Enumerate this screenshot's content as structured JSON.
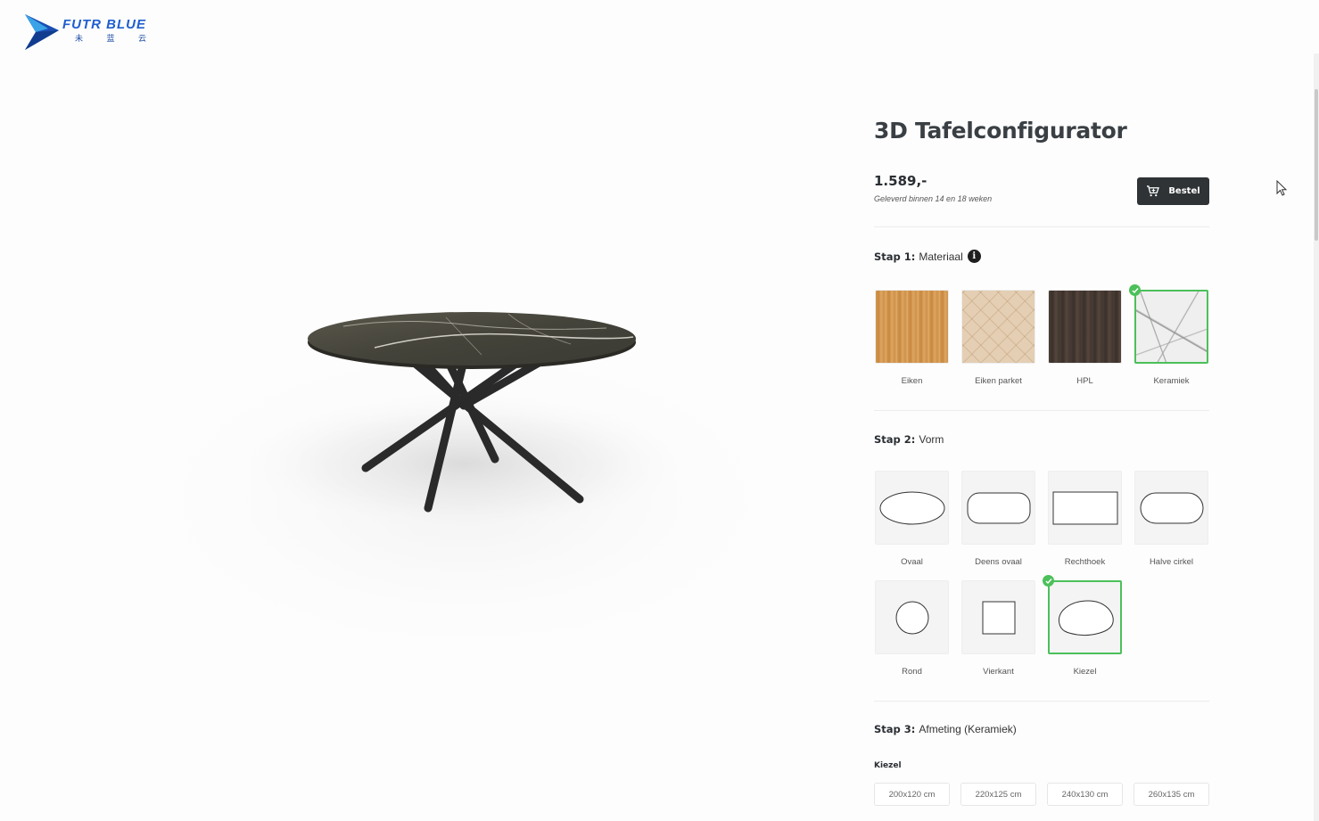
{
  "brand": {
    "name": "FUTR BLUE",
    "subtitle": "未 蓝 云"
  },
  "configurator": {
    "title": "3D Tafelconfigurator",
    "price": "1.589,-",
    "delivery": "Geleverd binnen 14 en 18 weken",
    "order_label": "Bestel"
  },
  "step1": {
    "label": "Stap 1:",
    "title": "Materiaal",
    "info_icon": "info-icon",
    "options": [
      {
        "label": "Eiken",
        "swatch": "oak",
        "selected": false
      },
      {
        "label": "Eiken parket",
        "swatch": "parquet",
        "selected": false
      },
      {
        "label": "HPL",
        "swatch": "hpl",
        "selected": false
      },
      {
        "label": "Keramiek",
        "swatch": "ceramic",
        "selected": true
      }
    ]
  },
  "step2": {
    "label": "Stap 2:",
    "title": "Vorm",
    "options": [
      {
        "label": "Ovaal",
        "shape": "oval",
        "selected": false
      },
      {
        "label": "Deens ovaal",
        "shape": "danish-oval",
        "selected": false
      },
      {
        "label": "Rechthoek",
        "shape": "rectangle",
        "selected": false
      },
      {
        "label": "Halve cirkel",
        "shape": "half-circle",
        "selected": false
      },
      {
        "label": "Rond",
        "shape": "round",
        "selected": false
      },
      {
        "label": "Vierkant",
        "shape": "square",
        "selected": false
      },
      {
        "label": "Kiezel",
        "shape": "pebble",
        "selected": true
      }
    ]
  },
  "step3": {
    "label": "Stap 3:",
    "title": "Afmeting (Keramiek)",
    "shape_label": "Kiezel",
    "sizes": [
      "200x120 cm",
      "220x125 cm",
      "240x130 cm",
      "260x135 cm"
    ]
  },
  "colors": {
    "selected": "#4cc05a",
    "button": "#2f3336",
    "brand": "#1f5fd0"
  }
}
